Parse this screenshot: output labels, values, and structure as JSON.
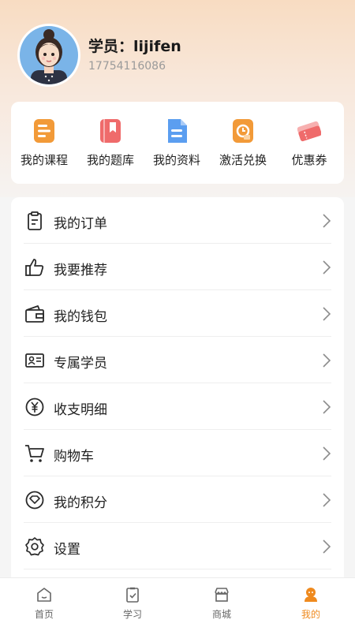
{
  "profile": {
    "name": "学员：lijifen",
    "phone": "17754116086"
  },
  "quick_links": [
    {
      "label": "我的课程",
      "icon": "course-icon",
      "color": "#f29a38"
    },
    {
      "label": "我的题库",
      "icon": "question-bank-icon",
      "color": "#ef6b6b"
    },
    {
      "label": "我的资料",
      "icon": "document-icon",
      "color": "#5b9ef0"
    },
    {
      "label": "激活兑换",
      "icon": "redeem-icon",
      "color": "#f29a38"
    },
    {
      "label": "优惠券",
      "icon": "coupon-icon",
      "color": "#ef6b6b"
    }
  ],
  "menu": [
    {
      "label": "我的订单",
      "icon": "clipboard-icon"
    },
    {
      "label": "我要推荐",
      "icon": "thumbs-up-icon"
    },
    {
      "label": "我的钱包",
      "icon": "wallet-icon"
    },
    {
      "label": "专属学员",
      "icon": "id-card-icon"
    },
    {
      "label": "收支明细",
      "icon": "yen-icon"
    },
    {
      "label": "购物车",
      "icon": "cart-icon"
    },
    {
      "label": "我的积分",
      "icon": "points-icon"
    },
    {
      "label": "设置",
      "icon": "gear-icon"
    }
  ],
  "tabbar": [
    {
      "label": "首页",
      "icon": "home-icon",
      "active": false
    },
    {
      "label": "学习",
      "icon": "study-icon",
      "active": false
    },
    {
      "label": "商城",
      "icon": "store-icon",
      "active": false
    },
    {
      "label": "我的",
      "icon": "profile-icon",
      "active": true
    }
  ],
  "colors": {
    "accent": "#ef8a1e",
    "header_gradient_top": "#f8dcc2"
  }
}
